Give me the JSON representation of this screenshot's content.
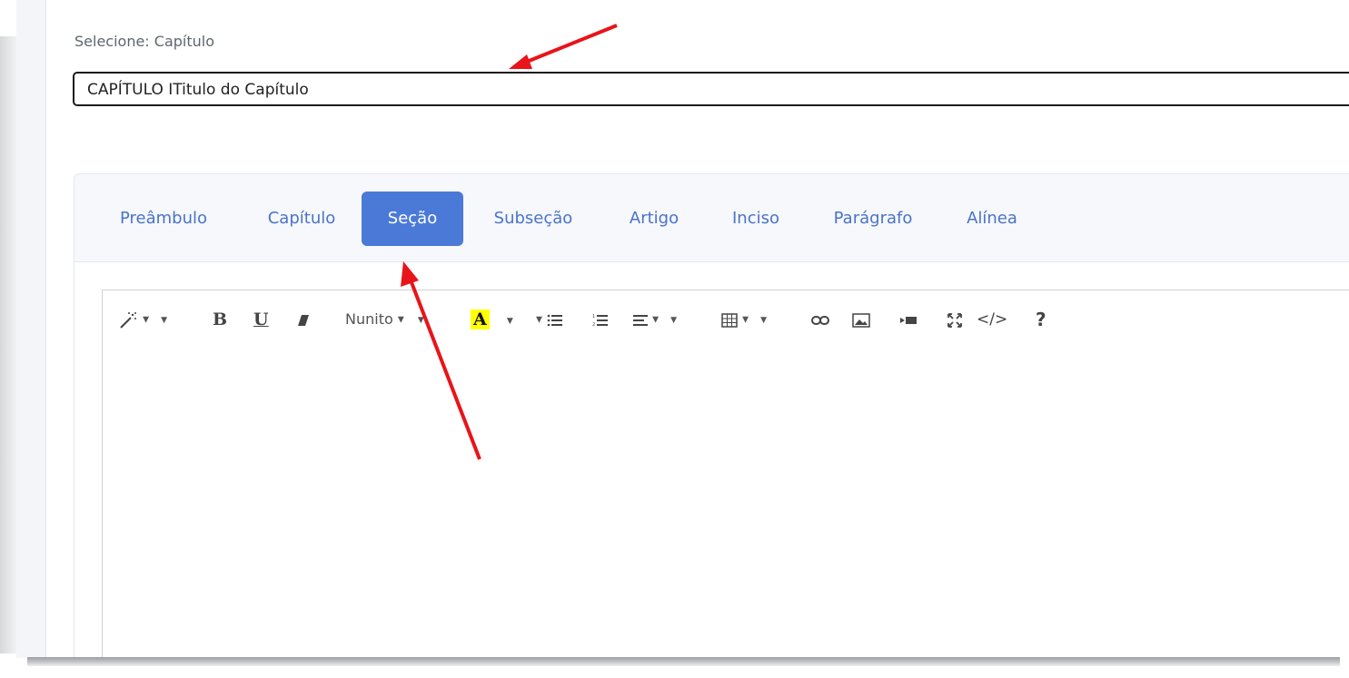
{
  "form": {
    "label": "Selecione: Capítulo",
    "selected_value": "CAPÍTULO ITitulo do Capítulo"
  },
  "tabs": [
    {
      "label": "Preâmbulo",
      "active": false
    },
    {
      "label": "Capítulo",
      "active": false
    },
    {
      "label": "Seção",
      "active": true
    },
    {
      "label": "Subseção",
      "active": false
    },
    {
      "label": "Artigo",
      "active": false
    },
    {
      "label": "Inciso",
      "active": false
    },
    {
      "label": "Parágrafo",
      "active": false
    },
    {
      "label": "Alínea",
      "active": false
    }
  ],
  "toolbar": {
    "style_icon": "magic-wand-icon",
    "bold": "B",
    "underline": "U",
    "eraser_icon": "eraser-icon",
    "font_name": "Nunito",
    "color_letter": "A",
    "ul_icon": "unordered-list-icon",
    "ol_icon": "ordered-list-icon",
    "align_icon": "align-icon",
    "table_icon": "table-icon",
    "link_icon": "link-icon",
    "picture_icon": "picture-icon",
    "video_icon": "video-icon",
    "fullscreen_icon": "fullscreen-icon",
    "code_view": "</>",
    "help": "?"
  },
  "colors": {
    "accent": "#4a79d8",
    "tab_text": "#4a73c9",
    "annotation": "#e8141a",
    "highlight": "#ffff00"
  }
}
